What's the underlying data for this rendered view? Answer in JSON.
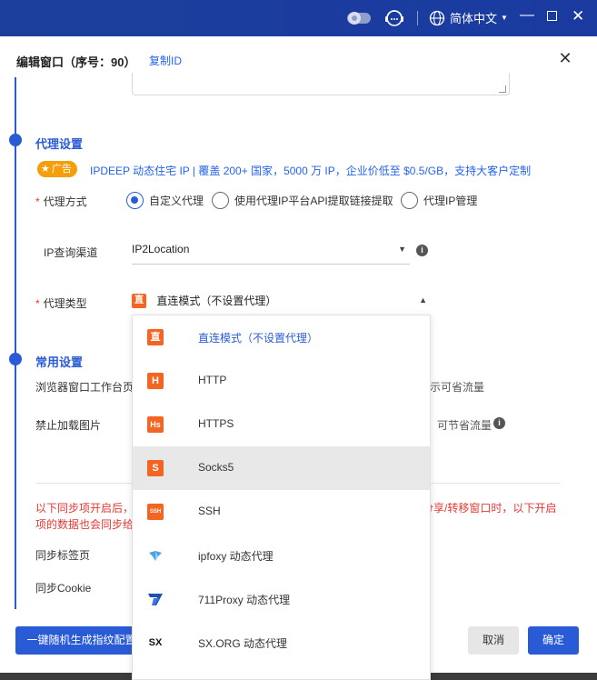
{
  "topbar": {
    "language": "简体中文"
  },
  "dialog": {
    "title": "编辑窗口（序号：90）",
    "copy_id": "复制ID",
    "sections": {
      "proxy": "代理设置",
      "common": "常用设置"
    },
    "ad": {
      "badge": "广告",
      "text": "IPDEEP 动态住宅 IP | 覆盖 200+ 国家，5000 万 IP，企业价低至 $0.5/GB，支持大客户定制"
    },
    "proxy_method": {
      "label": "代理方式",
      "options": [
        "自定义代理",
        "使用代理IP平台API提取链接提取",
        "代理IP管理"
      ],
      "selected_index": 0
    },
    "ip_channel": {
      "label": "IP查询渠道",
      "value": "IP2Location"
    },
    "proxy_type": {
      "label": "代理类型",
      "value": "直连模式（不设置代理）",
      "icon_text": "直"
    },
    "common": {
      "workbench_label": "浏览器窗口工作台页",
      "workbench_tail": "示可省流量",
      "disable_images_label": "禁止加载图片",
      "disable_images_tail": "可节省流量"
    },
    "sync_note_line1_left": "以下同步项开启后，",
    "sync_note_line1_right": "分享/转移窗口时，以下开启",
    "sync_note_line2_left": "项的数据也会同步给",
    "sync_tabs_label": "同步标签页",
    "sync_cookie_label": "同步Cookie",
    "buttons": {
      "random_fingerprint": "一键随机生成指纹配置",
      "cancel": "取消",
      "confirm": "确定"
    }
  },
  "dropdown": {
    "items": [
      {
        "label": "直连模式（不设置代理）",
        "icon": "直",
        "color": "#f26522",
        "selected": true
      },
      {
        "label": "HTTP",
        "icon": "H",
        "color": "#f26522"
      },
      {
        "label": "HTTPS",
        "icon": "Hs",
        "color": "#f26522"
      },
      {
        "label": "Socks5",
        "icon": "S",
        "color": "#f26522",
        "hover": true
      },
      {
        "label": "SSH",
        "icon": "SSH",
        "color": "#f26522"
      },
      {
        "label": "ipfoxy 动态代理",
        "icon": "ipfoxy-logo",
        "color": "#4aa3df"
      },
      {
        "label": "711Proxy 动态代理",
        "icon": "711-logo",
        "color": "#1f4fb0"
      },
      {
        "label": "SX.ORG 动态代理",
        "icon": "SX",
        "color": "#111111"
      }
    ]
  }
}
